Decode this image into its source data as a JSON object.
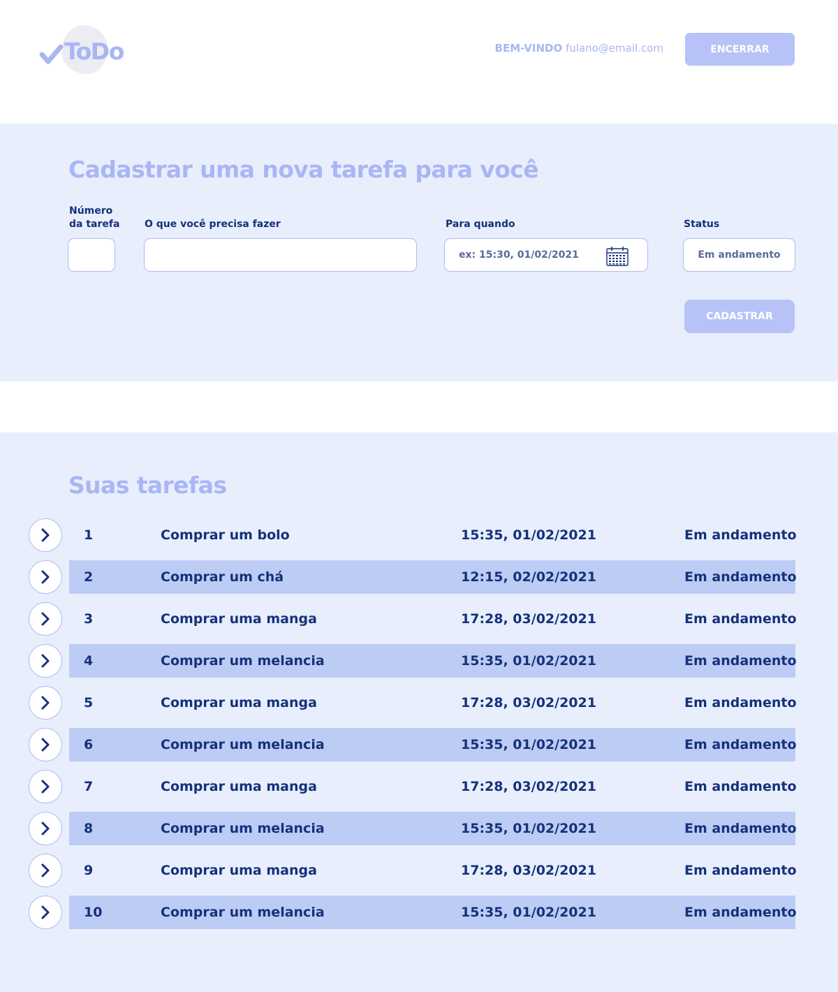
{
  "colors": {
    "accent": "#a9b6f4",
    "button": "#b7c3f7",
    "section_bg": "#e8eefc",
    "row_alt_bg": "#bdccf4",
    "text_dark": "#15317a"
  },
  "header": {
    "logo_text": "ToDo",
    "logo_icon": "check-icon",
    "welcome_label": "BEM-VINDO",
    "user_email": "fulano@email.com",
    "logout_label": "ENCERRAR"
  },
  "form": {
    "title": "Cadastrar uma nova tarefa para você",
    "number_label_line1": "Número",
    "number_label_line2": "da tarefa",
    "number_value": "",
    "task_label": "O que você precisa fazer",
    "task_value": "",
    "when_label": "Para quando",
    "when_placeholder": "ex: 15:30, 01/02/2021",
    "when_icon": "calendar-icon",
    "status_label": "Status",
    "status_value": "Em andamento",
    "submit_label": "CADASTRAR"
  },
  "tasks": {
    "title": "Suas tarefas",
    "row_icon": "chevron-right-icon",
    "rows": [
      {
        "number": "1",
        "description": "Comprar um bolo",
        "due": "15:35, 01/02/2021",
        "status": "Em andamento"
      },
      {
        "number": "2",
        "description": "Comprar um chá",
        "due": "12:15, 02/02/2021",
        "status": "Em andamento"
      },
      {
        "number": "3",
        "description": "Comprar uma manga",
        "due": "17:28, 03/02/2021",
        "status": "Em andamento"
      },
      {
        "number": "4",
        "description": "Comprar um melancia",
        "due": "15:35, 01/02/2021",
        "status": "Em andamento"
      },
      {
        "number": "5",
        "description": "Comprar uma manga",
        "due": "17:28, 03/02/2021",
        "status": "Em andamento"
      },
      {
        "number": "6",
        "description": "Comprar um melancia",
        "due": "15:35, 01/02/2021",
        "status": "Em andamento"
      },
      {
        "number": "7",
        "description": "Comprar uma manga",
        "due": "17:28, 03/02/2021",
        "status": "Em andamento"
      },
      {
        "number": "8",
        "description": "Comprar um melancia",
        "due": "15:35, 01/02/2021",
        "status": "Em andamento"
      },
      {
        "number": "9",
        "description": "Comprar uma manga",
        "due": "17:28, 03/02/2021",
        "status": "Em andamento"
      },
      {
        "number": "10",
        "description": "Comprar um melancia",
        "due": "15:35, 01/02/2021",
        "status": "Em andamento"
      }
    ]
  }
}
